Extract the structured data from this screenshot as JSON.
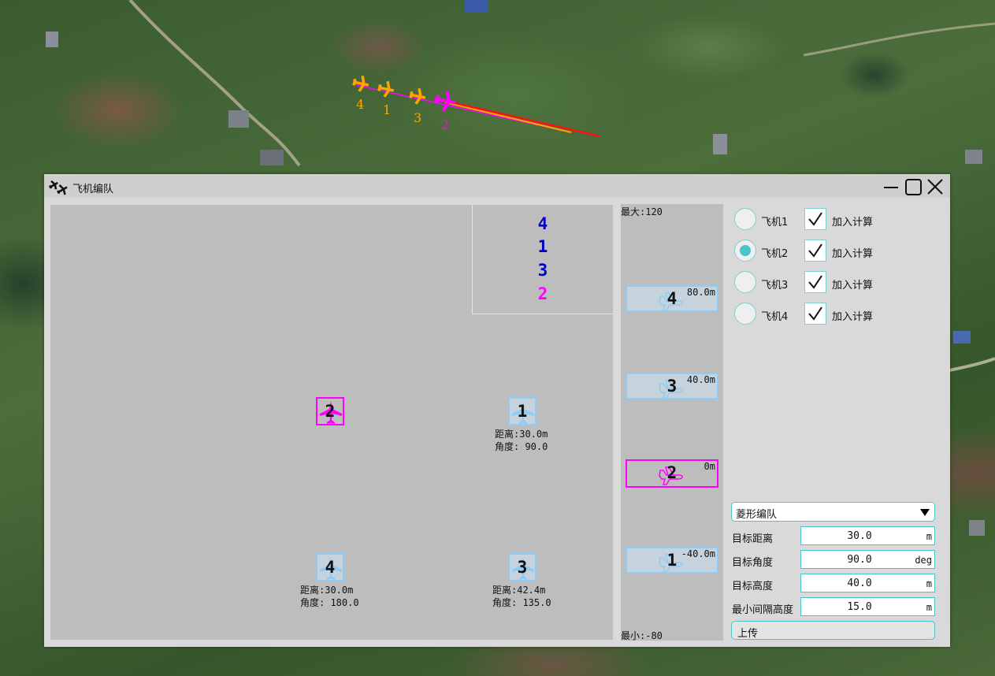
{
  "map": {
    "trail": [
      {
        "id": "4",
        "color": "#ffa500"
      },
      {
        "id": "1",
        "color": "#ffa500"
      },
      {
        "id": "3",
        "color": "#ffa500"
      },
      {
        "id": "2",
        "color": "#ff00ff"
      }
    ]
  },
  "window": {
    "title": "飞机编队"
  },
  "order_panel": {
    "items": [
      {
        "label": "4",
        "color": "#0000c8"
      },
      {
        "label": "1",
        "color": "#0000c8"
      },
      {
        "label": "3",
        "color": "#0000c8"
      },
      {
        "label": "2",
        "color": "#ff00ff"
      }
    ]
  },
  "formation": {
    "planes": [
      {
        "id": "2",
        "selected": true,
        "distance": "",
        "angle": ""
      },
      {
        "id": "1",
        "selected": false,
        "distance": "距离:30.0m",
        "angle": "角度: 90.0"
      },
      {
        "id": "4",
        "selected": false,
        "distance": "距离:30.0m",
        "angle": "角度: 180.0"
      },
      {
        "id": "3",
        "selected": false,
        "distance": "距离:42.4m",
        "angle": "角度: 135.0"
      }
    ]
  },
  "altitude": {
    "max_label": "最大:120",
    "min_label": "最小:-80",
    "planes": [
      {
        "id": "4",
        "value": "80.0m",
        "selected": false
      },
      {
        "id": "3",
        "value": "40.0m",
        "selected": false
      },
      {
        "id": "2",
        "value": "0m",
        "selected": true
      },
      {
        "id": "1",
        "value": "-40.0m",
        "selected": false
      }
    ]
  },
  "aircraft_list": [
    {
      "name": "飞机1",
      "selected": false,
      "include_label": "加入计算",
      "included": true
    },
    {
      "name": "飞机2",
      "selected": true,
      "include_label": "加入计算",
      "included": true
    },
    {
      "name": "飞机3",
      "selected": false,
      "include_label": "加入计算",
      "included": true
    },
    {
      "name": "飞机4",
      "selected": false,
      "include_label": "加入计算",
      "included": true
    }
  ],
  "formation_type": {
    "selected": "菱形编队"
  },
  "params": [
    {
      "label": "目标距离",
      "value": "30.0",
      "unit": "m"
    },
    {
      "label": "目标角度",
      "value": "90.0",
      "unit": "deg"
    },
    {
      "label": "目标高度",
      "value": "40.0",
      "unit": "m"
    },
    {
      "label": "最小间隔高度",
      "value": "15.0",
      "unit": "m"
    }
  ],
  "upload_label": "上传",
  "colors": {
    "accent": "#49c4c7",
    "selected": "#ff00ff",
    "plane_box": "#8fcbf2"
  }
}
